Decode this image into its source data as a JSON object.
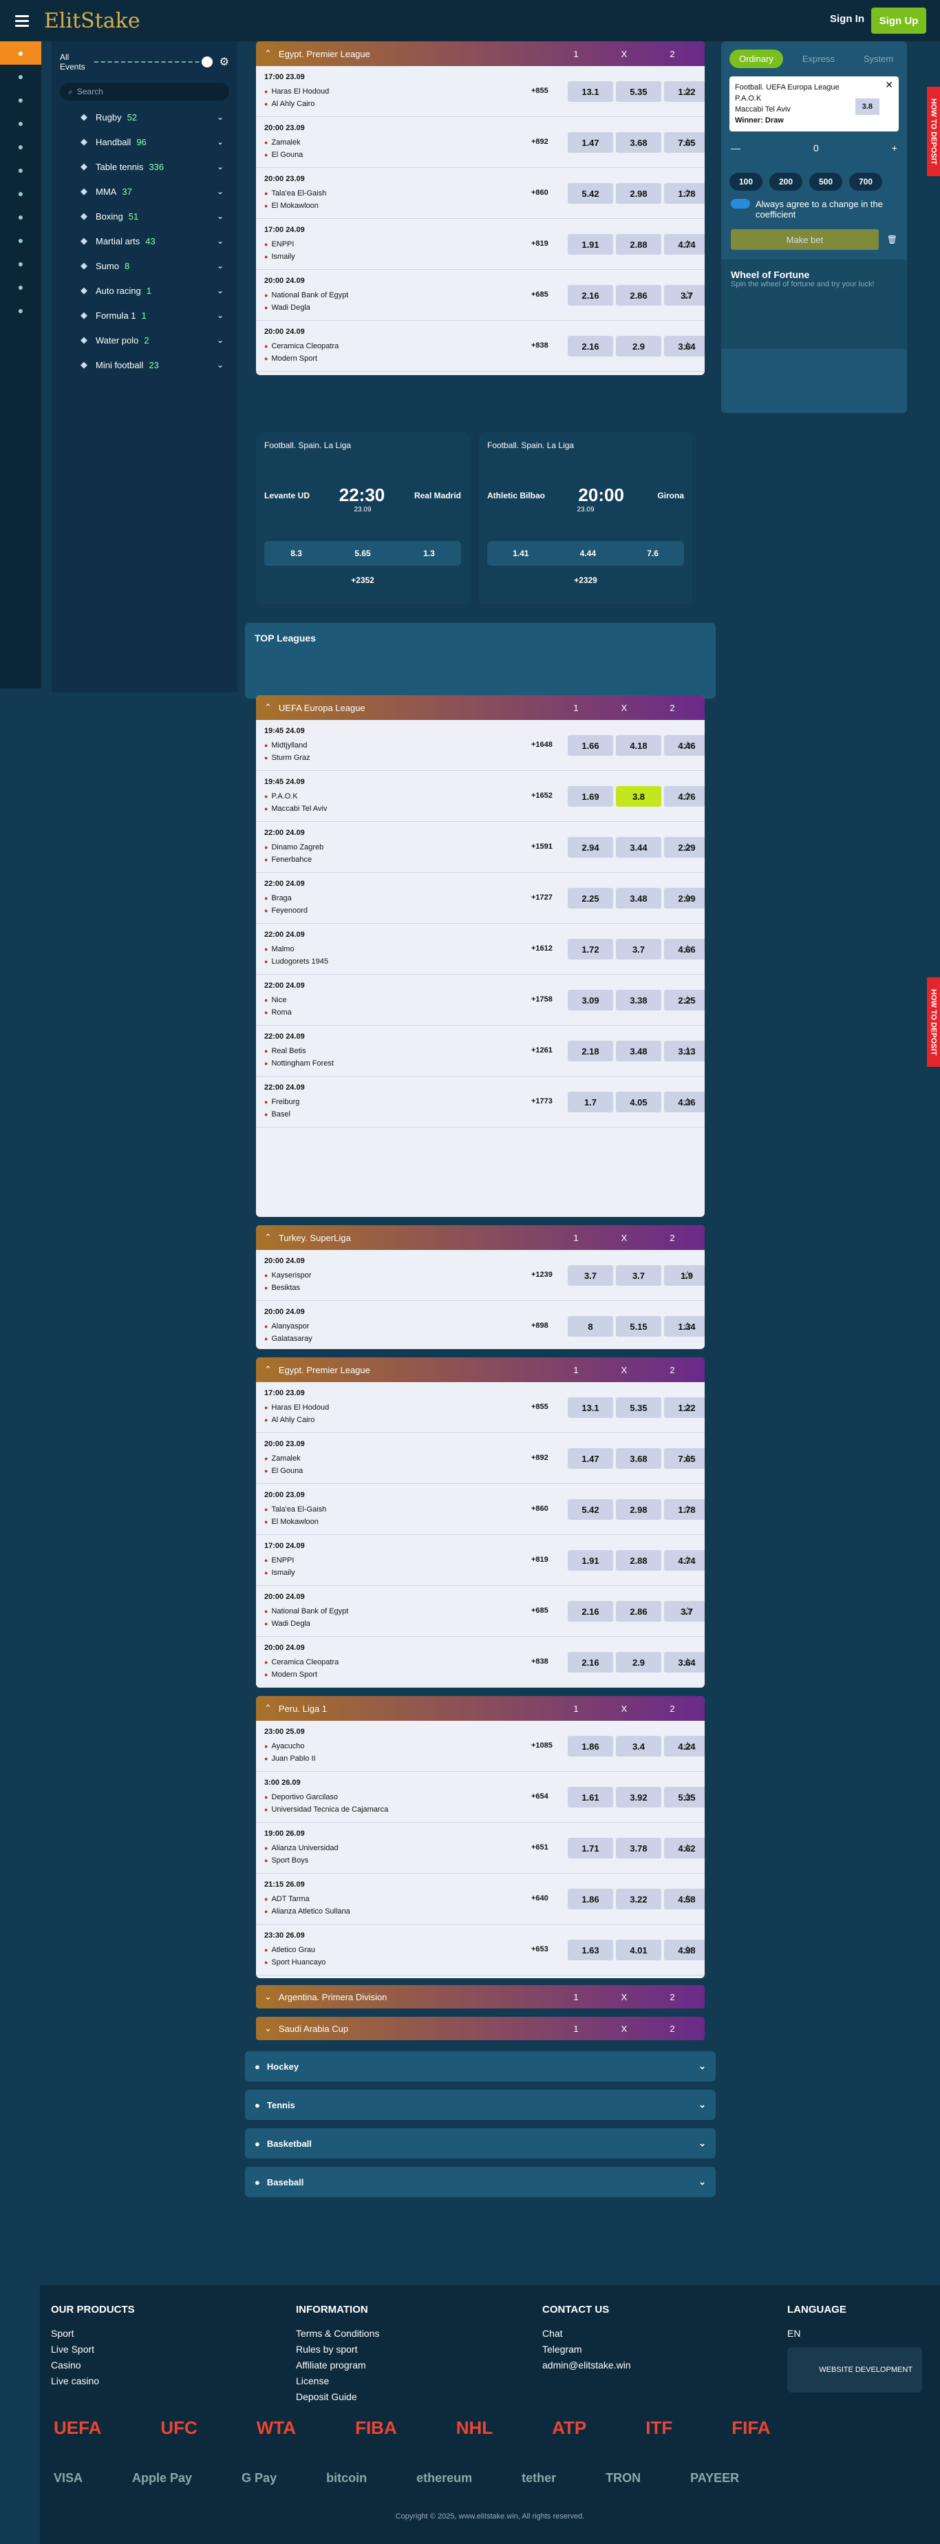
{
  "header": {
    "logo": "ElitStake",
    "login": "Sign In",
    "signup": "Sign Up"
  },
  "sidebar": {
    "all_events": "All Events",
    "search": "Search",
    "items": [
      {
        "n": "Rugby",
        "c": "52"
      },
      {
        "n": "Handball",
        "c": "96"
      },
      {
        "n": "Table tennis",
        "c": "336"
      },
      {
        "n": "MMA",
        "c": "37"
      },
      {
        "n": "Boxing",
        "c": "51"
      },
      {
        "n": "Martial arts",
        "c": "43"
      },
      {
        "n": "Sumo",
        "c": "8"
      },
      {
        "n": "Auto racing",
        "c": "1"
      },
      {
        "n": "Formula 1",
        "c": "1"
      },
      {
        "n": "Water polo",
        "c": "2"
      },
      {
        "n": "Mini football",
        "c": "23"
      }
    ]
  },
  "betslip": {
    "tabs": [
      "Ordinary",
      "Express",
      "System"
    ],
    "league": "Football. UEFA Europa League",
    "team1": "P.A.O.K",
    "team2": "Maccabi Tel Aviv",
    "winner": "Winner: Draw",
    "coef": "3.8",
    "stake": "0",
    "amounts": [
      "100",
      "200",
      "500",
      "700"
    ],
    "agree": "Always agree to a change in the coefficient",
    "make": "Make bet",
    "wheel": "Wheel of Fortune",
    "wheel_sub": "Spin the wheel of fortune and try your luck!",
    "deposit": "HOW TO DEPOSIT"
  },
  "featured": [
    {
      "league": "Football. Spain. La Liga",
      "t1": "Levante UD",
      "t2": "Real Madrid",
      "time": "22:30",
      "date": "23.09",
      "o": [
        "8.3",
        "5.65",
        "1.3"
      ],
      "more": "+2352"
    },
    {
      "league": "Football. Spain. La Liga",
      "t1": "Athletic Bilbao",
      "t2": "Girona",
      "time": "20:00",
      "date": "23.09",
      "o": [
        "1.41",
        "4.44",
        "7.6"
      ],
      "more": "+2329"
    }
  ],
  "top_leagues": "TOP Leagues",
  "europa": {
    "name": "UEFA Europa League",
    "rows": [
      {
        "d": "19:45 24.09",
        "t1": "Midtjylland",
        "t2": "Sturm Graz",
        "c": "+1648",
        "o": [
          "1.66",
          "4.18",
          "4.46"
        ]
      },
      {
        "d": "19:45 24.09",
        "t1": "P.A.O.K",
        "t2": "Maccabi Tel Aviv",
        "c": "+1652",
        "o": [
          "1.69",
          "3.8",
          "4.76"
        ]
      },
      {
        "d": "22:00 24.09",
        "t1": "Dinamo Zagreb",
        "t2": "Fenerbahce",
        "c": "+1591",
        "o": [
          "2.94",
          "3.44",
          "2.29"
        ]
      },
      {
        "d": "22:00 24.09",
        "t1": "Braga",
        "t2": "Feyenoord",
        "c": "+1727",
        "o": [
          "2.25",
          "3.48",
          "2.99"
        ]
      },
      {
        "d": "22:00 24.09",
        "t1": "Malmo",
        "t2": "Ludogorets 1945",
        "c": "+1612",
        "o": [
          "1.72",
          "3.7",
          "4.66"
        ]
      },
      {
        "d": "22:00 24.09",
        "t1": "Nice",
        "t2": "Roma",
        "c": "+1758",
        "o": [
          "3.09",
          "3.38",
          "2.25"
        ]
      },
      {
        "d": "22:00 24.09",
        "t1": "Real Betis",
        "t2": "Nottingham Forest",
        "c": "+1261",
        "o": [
          "2.18",
          "3.48",
          "3.13"
        ]
      },
      {
        "d": "22:00 24.09",
        "t1": "Freiburg",
        "t2": "Basel",
        "c": "+1773",
        "o": [
          "1.7",
          "4.05",
          "4.36"
        ]
      }
    ]
  },
  "turkey": {
    "name": "Turkey. SuperLiga",
    "rows": [
      {
        "d": "20:00 24.09",
        "t1": "Kayserispor",
        "t2": "Besiktas",
        "c": "+1239",
        "o": [
          "3.7",
          "3.7",
          "1.9"
        ]
      },
      {
        "d": "20:00 24.09",
        "t1": "Alanyaspor",
        "t2": "Galatasaray",
        "c": "+898",
        "o": [
          "8",
          "5.15",
          "1.34"
        ]
      }
    ]
  },
  "egypt": {
    "name": "Egypt. Premier League",
    "rows": [
      {
        "d": "17:00 23.09",
        "t1": "Haras El Hodoud",
        "t2": "Al Ahly Cairo",
        "c": "+855",
        "o": [
          "13.1",
          "5.35",
          "1.22"
        ]
      },
      {
        "d": "20:00 23.09",
        "t1": "Zamalek",
        "t2": "El Gouna",
        "c": "+892",
        "o": [
          "1.47",
          "3.68",
          "7.65"
        ]
      },
      {
        "d": "20:00 23.09",
        "t1": "Tala'ea El-Gaish",
        "t2": "El Mokawloon",
        "c": "+860",
        "o": [
          "5.42",
          "2.98",
          "1.78"
        ]
      },
      {
        "d": "17:00 24.09",
        "t1": "ENPPI",
        "t2": "Ismaily",
        "c": "+819",
        "o": [
          "1.91",
          "2.88",
          "4.74"
        ]
      },
      {
        "d": "20:00 24.09",
        "t1": "National Bank of Egypt",
        "t2": "Wadi Degla",
        "c": "+685",
        "o": [
          "2.16",
          "2.86",
          "3.7"
        ]
      },
      {
        "d": "20:00 24.09",
        "t1": "Ceramica Cleopatra",
        "t2": "Modern Sport",
        "c": "+838",
        "o": [
          "2.16",
          "2.9",
          "3.64"
        ]
      }
    ]
  },
  "peru": {
    "name": "Peru. Liga 1",
    "rows": [
      {
        "d": "23:00 25.09",
        "t1": "Ayacucho",
        "t2": "Juan Pablo II",
        "c": "+1085",
        "o": [
          "1.86",
          "3.4",
          "4.24"
        ]
      },
      {
        "d": "3:00 26.09",
        "t1": "Deportivo Garcilaso",
        "t2": "Universidad Tecnica de Cajamarca",
        "c": "+654",
        "o": [
          "1.61",
          "3.92",
          "5.35"
        ]
      },
      {
        "d": "19:00 26.09",
        "t1": "Alianza Universidad",
        "t2": "Sport Boys",
        "c": "+651",
        "o": [
          "1.71",
          "3.78",
          "4.62"
        ]
      },
      {
        "d": "21:15 26.09",
        "t1": "ADT Tarma",
        "t2": "Alianza Atletico Sullana",
        "c": "+640",
        "o": [
          "1.86",
          "3.22",
          "4.58"
        ]
      },
      {
        "d": "23:30 26.09",
        "t1": "Atletico Grau",
        "t2": "Sport Huancayo",
        "c": "+653",
        "o": [
          "1.63",
          "4.01",
          "4.98"
        ]
      }
    ]
  },
  "collapsed": [
    "Argentina. Primera Division",
    "Saudi Arabia Cup"
  ],
  "sports": [
    "Hockey",
    "Tennis",
    "Basketball",
    "Baseball"
  ],
  "footer": {
    "products": {
      "title": "OUR PRODUCTS",
      "items": [
        "Sport",
        "Live Sport",
        "Casino",
        "Live casino"
      ]
    },
    "info": {
      "title": "INFORMATION",
      "items": [
        "Terms & Conditions",
        "Rules by sport",
        "Affiliate program",
        "License",
        "Deposit Guide"
      ]
    },
    "contact": {
      "title": "CONTACT US",
      "items": [
        "Chat",
        "Telegram",
        "admin@elitstake.win"
      ]
    },
    "lang": {
      "title": "LANGUAGE",
      "value": "EN"
    },
    "dev": "WEBSITE DEVELOPMENT",
    "logos": [
      "UEFA",
      "UFC",
      "WTA",
      "FIBA",
      "NHL",
      "ATP",
      "ITF",
      "FIFA"
    ],
    "pays": [
      "VISA",
      "Apple Pay",
      "G Pay",
      "bitcoin",
      "ethereum",
      "tether",
      "TRON",
      "PAYEER"
    ],
    "copy": "Copyright © 2025, www.elitstake.win, All rights reserved."
  }
}
